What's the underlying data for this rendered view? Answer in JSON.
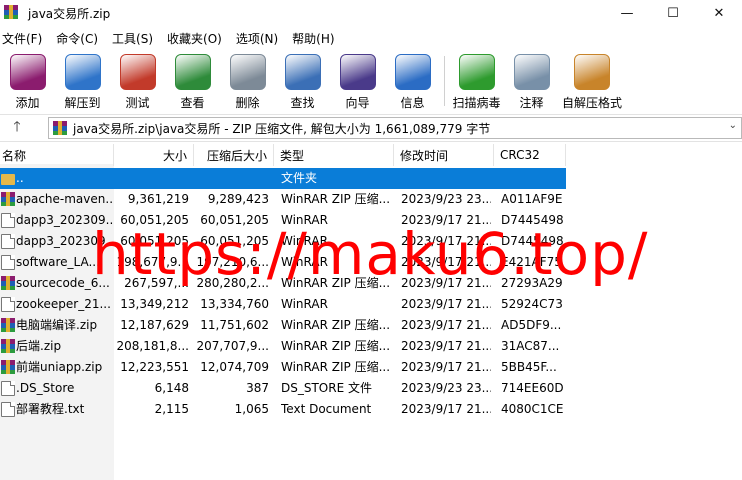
{
  "window": {
    "title": "java交易所.zip",
    "minimize": "—",
    "maximize": "☐",
    "close": "✕"
  },
  "menu": [
    "文件(F)",
    "命令(C)",
    "工具(S)",
    "收藏夹(O)",
    "选项(N)",
    "帮助(H)"
  ],
  "toolbar": [
    {
      "label": "添加",
      "icon": "add-archive-icon",
      "color": "#8b1c6e"
    },
    {
      "label": "解压到",
      "icon": "extract-to-icon",
      "color": "#2f74c9"
    },
    {
      "label": "测试",
      "icon": "test-icon",
      "color": "#c23a2a"
    },
    {
      "label": "查看",
      "icon": "view-book-icon",
      "color": "#2e8b3a"
    },
    {
      "label": "删除",
      "icon": "trash-icon",
      "color": "#7d8a97"
    },
    {
      "label": "查找",
      "icon": "magnifier-icon",
      "color": "#3b6fb6"
    },
    {
      "label": "向导",
      "icon": "wizard-wand-icon",
      "color": "#4a3a8a"
    },
    {
      "label": "信息",
      "icon": "info-icon",
      "color": "#2b6cc4"
    },
    {
      "label": "扫描病毒",
      "icon": "virus-scan-icon",
      "color": "#2e9b2e"
    },
    {
      "label": "注释",
      "icon": "comment-icon",
      "color": "#7890a8"
    },
    {
      "label": "自解压格式",
      "icon": "sfx-box-icon",
      "color": "#c8842a"
    }
  ],
  "address": {
    "up": "🡑",
    "path": "java交易所.zip\\java交易所 - ZIP 压缩文件, 解包大小为 1,661,089,779 字节",
    "dropdown": "⌄"
  },
  "columns": [
    "名称",
    "大小",
    "压缩后大小",
    "类型",
    "修改时间",
    "CRC32"
  ],
  "rows": [
    {
      "name": "..",
      "size": "",
      "packed": "",
      "type": "文件夹",
      "modified": "",
      "crc": "",
      "icon": "folder-icon",
      "selected": true
    },
    {
      "name": "apache-maven...",
      "size": "9,361,219",
      "packed": "9,289,423",
      "type": "WinRAR ZIP 压缩...",
      "modified": "2023/9/23 23...",
      "crc": "A011AF9E",
      "icon": "winrar-zip-icon"
    },
    {
      "name": "dapp3_202309...",
      "size": "60,051,205",
      "packed": "60,051,205",
      "type": "WinRAR",
      "modified": "2023/9/17 21...",
      "crc": "D7445498",
      "icon": "document-icon"
    },
    {
      "name": "dapp3_202309...",
      "size": "60,051,205",
      "packed": "60,051,205",
      "type": "WinRAR",
      "modified": "2023/9/17 21...",
      "crc": "D7445498",
      "icon": "document-icon"
    },
    {
      "name": "software_LA...",
      "size": "198,677,9...",
      "packed": "197,210,6...",
      "type": "WinRAR",
      "modified": "2023/9/17 21...",
      "crc": "E421AF75",
      "icon": "document-icon"
    },
    {
      "name": "sourcecode_6...",
      "size": "267,597,...",
      "packed": "280,280,2...",
      "type": "WinRAR ZIP 压缩...",
      "modified": "2023/9/17 21...",
      "crc": "27293A29",
      "icon": "winrar-zip-icon"
    },
    {
      "name": "zookeeper_21...",
      "size": "13,349,212",
      "packed": "13,334,760",
      "type": "WinRAR",
      "modified": "2023/9/17 21...",
      "crc": "52924C73",
      "icon": "document-icon"
    },
    {
      "name": "电脑端编译.zip",
      "size": "12,187,629",
      "packed": "11,751,602",
      "type": "WinRAR ZIP 压缩...",
      "modified": "2023/9/17 21...",
      "crc": "AD5DF9...",
      "icon": "winrar-zip-icon"
    },
    {
      "name": "后端.zip",
      "size": "208,181,8...",
      "packed": "207,707,9...",
      "type": "WinRAR ZIP 压缩...",
      "modified": "2023/9/17 21...",
      "crc": "31AC87...",
      "icon": "winrar-zip-icon"
    },
    {
      "name": "前端uniapp.zip",
      "size": "12,223,551",
      "packed": "12,074,709",
      "type": "WinRAR ZIP 压缩...",
      "modified": "2023/9/17 21...",
      "crc": "5BB45F...",
      "icon": "winrar-zip-icon"
    },
    {
      "name": ".DS_Store",
      "size": "6,148",
      "packed": "387",
      "type": "DS_STORE 文件",
      "modified": "2023/9/23 23...",
      "crc": "714EE60D",
      "icon": "document-icon"
    },
    {
      "name": "部署教程.txt",
      "size": "2,115",
      "packed": "1,065",
      "type": "Text Document",
      "modified": "2023/9/17 21...",
      "crc": "4080C1CE",
      "icon": "text-file-icon"
    }
  ],
  "watermark": "https://maku6.top/",
  "colors": {
    "selection": "#0a7dd8",
    "watermark": "#ff0000"
  }
}
